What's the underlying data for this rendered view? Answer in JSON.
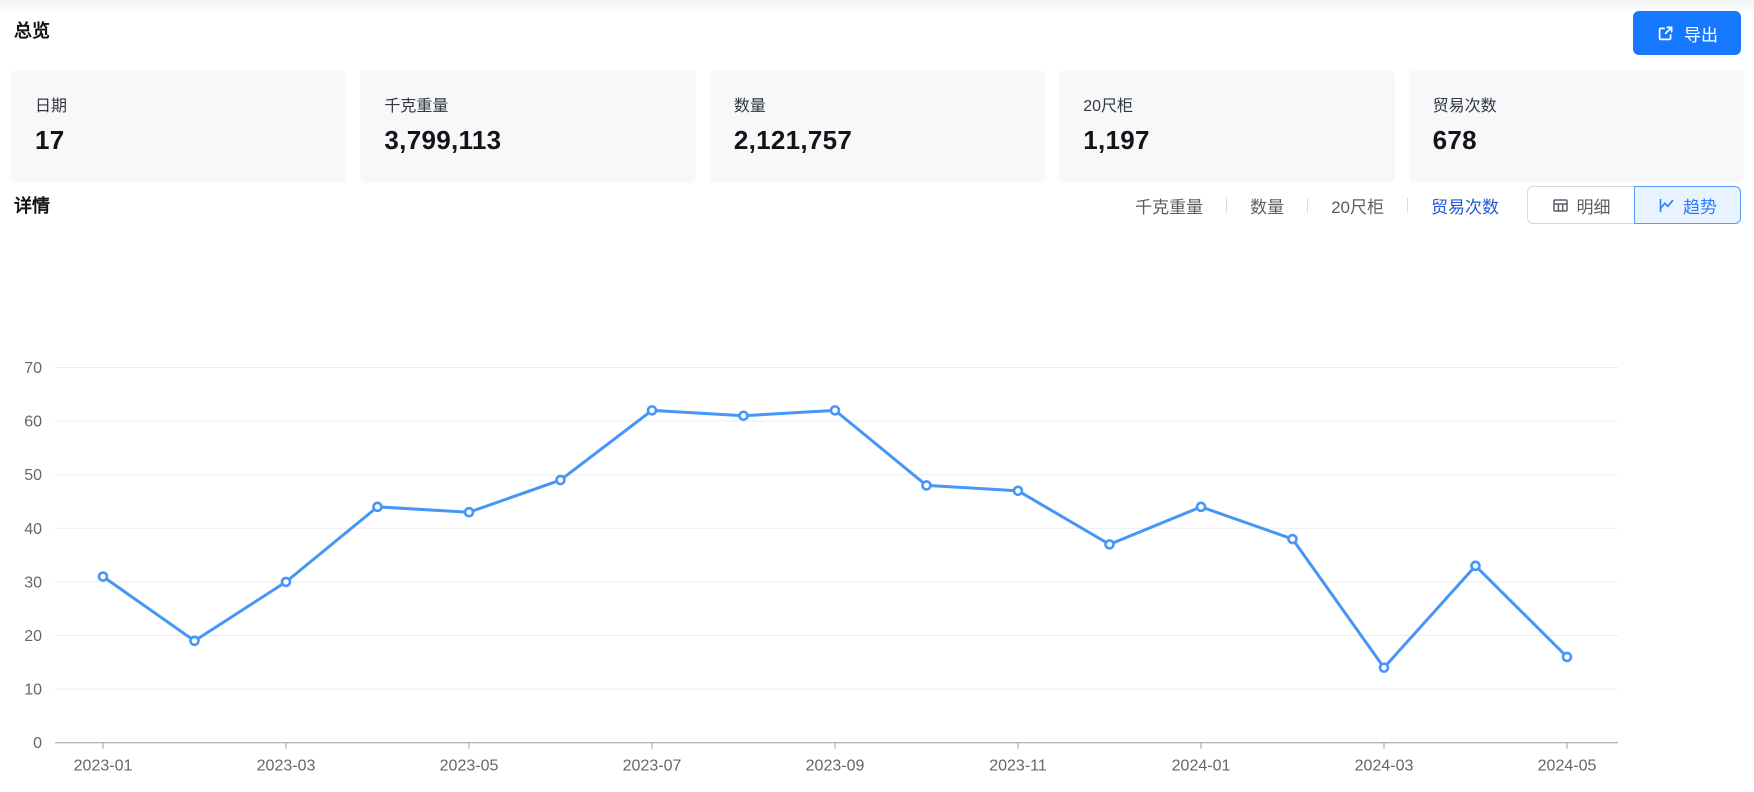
{
  "overview": {
    "title": "总览",
    "export_label": "导出",
    "cards": [
      {
        "label": "日期",
        "value": "17"
      },
      {
        "label": "千克重量",
        "value": "3,799,113"
      },
      {
        "label": "数量",
        "value": "2,121,757"
      },
      {
        "label": "20尺柜",
        "value": "1,197"
      },
      {
        "label": "贸易次数",
        "value": "678"
      }
    ]
  },
  "details": {
    "title": "详情",
    "metric_tabs": [
      {
        "label": "千克重量",
        "active": false
      },
      {
        "label": "数量",
        "active": false
      },
      {
        "label": "20尺柜",
        "active": false
      },
      {
        "label": "贸易次数",
        "active": true
      }
    ],
    "view_toggle": [
      {
        "label": "明细",
        "icon": "table-icon",
        "active": false
      },
      {
        "label": "趋势",
        "icon": "trend-icon",
        "active": true
      }
    ]
  },
  "colors": {
    "accent_button": "#1677ff",
    "active_tab_text": "#2457d6",
    "segment_active_text": "#2e7cf6",
    "segment_active_bg": "#e9f3ff",
    "line": "#4596f7",
    "gridline": "#e9edf3",
    "axis": "#989da5",
    "tick_label": "#62666d"
  },
  "chart_data": {
    "type": "line",
    "title": "",
    "xlabel": "",
    "ylabel": "",
    "x": [
      "2023-01",
      "2023-02",
      "2023-03",
      "2023-04",
      "2023-05",
      "2023-06",
      "2023-07",
      "2023-08",
      "2023-09",
      "2023-10",
      "2023-11",
      "2023-12",
      "2024-01",
      "2024-02",
      "2024-03",
      "2024-04",
      "2024-05"
    ],
    "x_tick_labels_shown": [
      "2023-01",
      "2023-03",
      "2023-05",
      "2023-07",
      "2023-09",
      "2023-11",
      "2024-01",
      "2024-03",
      "2024-05"
    ],
    "series": [
      {
        "name": "贸易次数",
        "values": [
          31,
          19,
          30,
          44,
          43,
          49,
          62,
          61,
          62,
          48,
          47,
          37,
          44,
          38,
          14,
          33,
          16
        ]
      }
    ],
    "ylim": [
      0,
      70
    ],
    "y_ticks": [
      0,
      10,
      20,
      30,
      40,
      50,
      60,
      70
    ],
    "grid": true,
    "legend_position": "none",
    "marker": "hollow-circle",
    "line_color": "#4596f7"
  }
}
